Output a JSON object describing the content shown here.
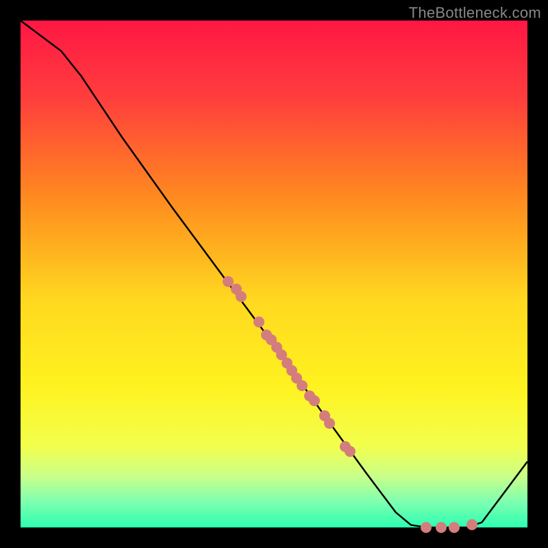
{
  "watermark": "TheBottleneck.com",
  "chart_data": {
    "type": "line",
    "title": "",
    "xlabel": "",
    "ylabel": "",
    "xlim": [
      0,
      100
    ],
    "ylim": [
      0,
      100
    ],
    "curve": [
      {
        "x": 0,
        "y": 100
      },
      {
        "x": 8,
        "y": 94
      },
      {
        "x": 12,
        "y": 89
      },
      {
        "x": 20,
        "y": 77
      },
      {
        "x": 30,
        "y": 63
      },
      {
        "x": 40,
        "y": 49.5
      },
      {
        "x": 50,
        "y": 36
      },
      {
        "x": 60,
        "y": 22
      },
      {
        "x": 68,
        "y": 11
      },
      {
        "x": 74,
        "y": 3
      },
      {
        "x": 77,
        "y": 0.5
      },
      {
        "x": 80,
        "y": 0
      },
      {
        "x": 88,
        "y": 0
      },
      {
        "x": 91,
        "y": 1
      },
      {
        "x": 100,
        "y": 13
      }
    ],
    "dots": [
      {
        "x": 41,
        "y": 48.5
      },
      {
        "x": 42.5,
        "y": 47
      },
      {
        "x": 43.5,
        "y": 45.5
      },
      {
        "x": 47,
        "y": 40.5
      },
      {
        "x": 48.5,
        "y": 38
      },
      {
        "x": 49.5,
        "y": 37
      },
      {
        "x": 50.5,
        "y": 35.5
      },
      {
        "x": 51.5,
        "y": 34
      },
      {
        "x": 52.5,
        "y": 32.5
      },
      {
        "x": 53.5,
        "y": 31
      },
      {
        "x": 54.5,
        "y": 29.5
      },
      {
        "x": 55.5,
        "y": 28
      },
      {
        "x": 57,
        "y": 26
      },
      {
        "x": 58,
        "y": 25
      },
      {
        "x": 60,
        "y": 22
      },
      {
        "x": 61,
        "y": 20.5
      },
      {
        "x": 64,
        "y": 16
      },
      {
        "x": 65,
        "y": 15
      },
      {
        "x": 80,
        "y": 0
      },
      {
        "x": 83,
        "y": 0
      },
      {
        "x": 85.5,
        "y": 0
      },
      {
        "x": 89,
        "y": 0.5
      }
    ],
    "gradient_stops": [
      {
        "offset": 0,
        "color": "#ff1744"
      },
      {
        "offset": 15,
        "color": "#ff3d3d"
      },
      {
        "offset": 35,
        "color": "#ff8a1f"
      },
      {
        "offset": 55,
        "color": "#ffd81f"
      },
      {
        "offset": 72,
        "color": "#fff21f"
      },
      {
        "offset": 84,
        "color": "#f2ff4d"
      },
      {
        "offset": 90,
        "color": "#c8ff8a"
      },
      {
        "offset": 95,
        "color": "#7dffb0"
      },
      {
        "offset": 100,
        "color": "#2dffb0"
      }
    ]
  }
}
